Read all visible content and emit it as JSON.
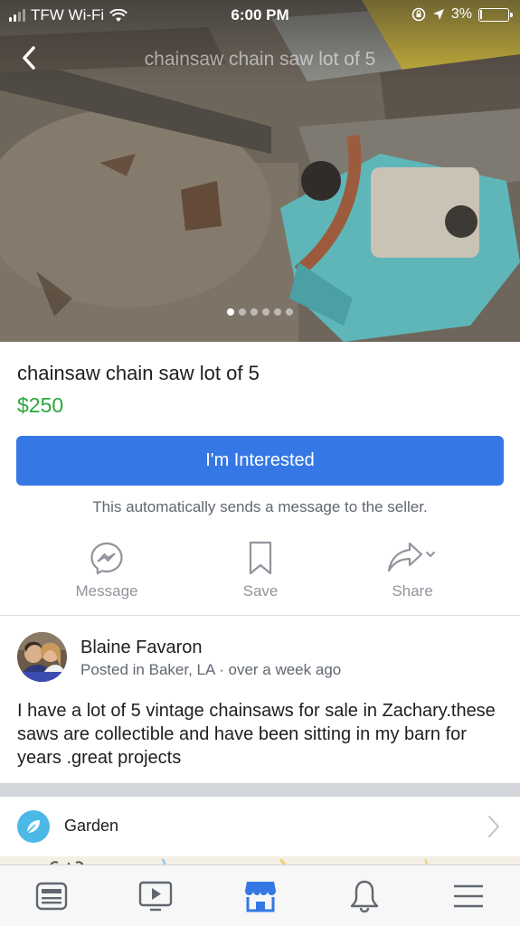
{
  "status_bar": {
    "carrier": "TFW Wi-Fi",
    "time": "6:00 PM",
    "battery": "3%"
  },
  "nav": {
    "title": "chainsaw chain saw lot of 5",
    "back_icon": "chevron-left-icon"
  },
  "gallery": {
    "photo_count": 6,
    "active_index": 0
  },
  "listing": {
    "title": "chainsaw chain saw lot of 5",
    "price": "$250",
    "price_color": "#2aa83a",
    "cta_label": "I'm Interested",
    "cta_color": "#3578e5",
    "cta_note": "This automatically sends a message to the seller."
  },
  "actions": [
    {
      "label": "Message",
      "icon": "messenger-icon"
    },
    {
      "label": "Save",
      "icon": "bookmark-icon"
    },
    {
      "label": "Share",
      "icon": "share-icon"
    }
  ],
  "seller": {
    "name": "Blaine Favaron",
    "meta": "Posted in Baker, LA · over a week ago"
  },
  "description": "I have a lot of 5 vintage chainsaws for sale in Zachary.these saws are collectible and have been sitting in my barn for years .great projects",
  "category": {
    "label": "Garden",
    "icon": "garden-icon"
  },
  "tabs": [
    {
      "name": "news-feed",
      "icon": "news-feed-icon",
      "active": false
    },
    {
      "name": "watch",
      "icon": "video-play-icon",
      "active": false
    },
    {
      "name": "marketplace",
      "icon": "marketplace-icon",
      "active": true
    },
    {
      "name": "notifications",
      "icon": "bell-icon",
      "active": false
    },
    {
      "name": "menu",
      "icon": "hamburger-menu-icon",
      "active": false
    }
  ],
  "colors": {
    "active_tab": "#3578e5",
    "inactive_tab": "#606770"
  }
}
